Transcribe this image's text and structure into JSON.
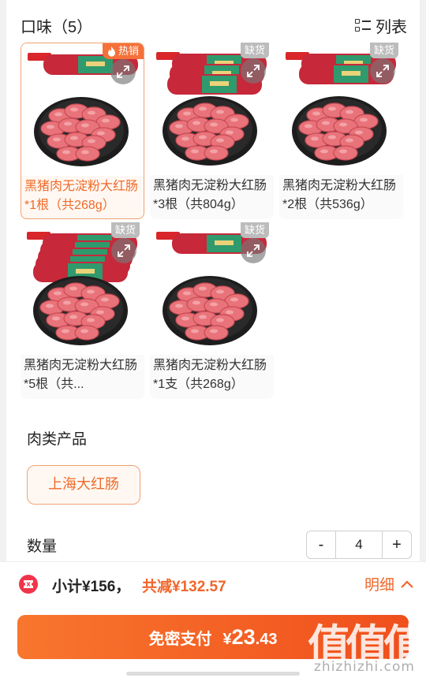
{
  "flavor": {
    "title": "口味（5）",
    "view_toggle_label": "列表",
    "options": [
      {
        "label": "黑猪肉无淀粉大红肠*1根（共268g）",
        "badge": "热销",
        "selected": true,
        "pack": 1
      },
      {
        "label": "黑猪肉无淀粉大红肠*3根（共804g）",
        "badge": "缺货",
        "selected": false,
        "pack": 3
      },
      {
        "label": "黑猪肉无淀粉大红肠*2根（共536g）",
        "badge": "缺货",
        "selected": false,
        "pack": 2
      },
      {
        "label": "黑猪肉无淀粉大红肠*5根（共...",
        "badge": "缺货",
        "selected": false,
        "pack": 5
      },
      {
        "label": "黑猪肉无淀粉大红肠*1支（共268g）",
        "badge": "缺货",
        "selected": false,
        "pack": 1
      }
    ]
  },
  "meat": {
    "title": "肉类产品",
    "option": "上海大红肠"
  },
  "quantity": {
    "label": "数量",
    "value": "4",
    "minus": "-",
    "plus": "+"
  },
  "summary": {
    "subtotal": "小计¥156，",
    "discount": "共减¥132.57",
    "detail_label": "明细"
  },
  "pay": {
    "label": "免密支付",
    "currency": "¥",
    "amount_int": "23",
    "amount_dec": ".43"
  },
  "watermark": {
    "main": "值值值",
    "sub": "zhizhizhi.com"
  },
  "colors": {
    "accent": "#f06a2a",
    "selected_border": "#f0a272",
    "hot_badge": "#f5713a",
    "out_badge": "#bcbcbc"
  },
  "icons": [
    "list-icon",
    "flame-icon",
    "expand-icon",
    "coupon-icon",
    "chevron-up-icon"
  ]
}
